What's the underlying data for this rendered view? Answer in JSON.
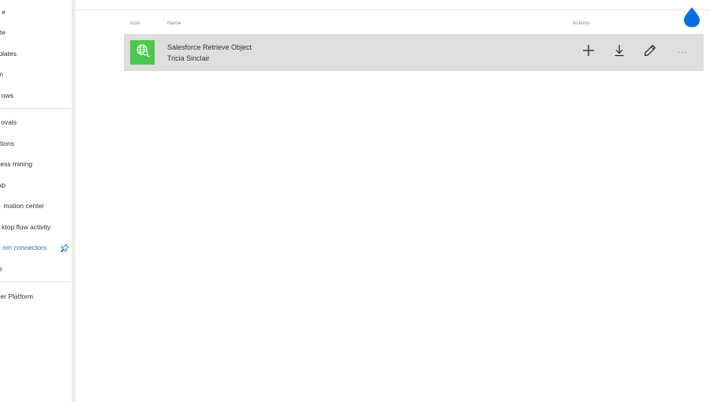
{
  "sidebar": {
    "items": [
      {
        "label": "e"
      },
      {
        "label": "te"
      },
      {
        "label": "plates"
      },
      {
        "label": "n"
      },
      {
        "label": "ows"
      },
      {
        "label": "ovals"
      },
      {
        "label": "tions"
      },
      {
        "label": "ess mining"
      },
      {
        "label": "ab"
      },
      {
        "label": "mation center"
      },
      {
        "label": "ktop flow activity"
      },
      {
        "label": "om connectors"
      },
      {
        "label": "e"
      },
      {
        "label": "er Platform"
      }
    ],
    "active_color": "#2b6cc4"
  },
  "table": {
    "headers": {
      "icon": "Icon",
      "name": "Name",
      "actions": "Actions"
    },
    "rows": [
      {
        "title": "Salesforce Retrieve Object",
        "owner": "Tricia Sinclair",
        "icon": "globe-search-icon",
        "icon_bg": "#4cc94c"
      }
    ]
  },
  "actions": {
    "more_label": "···"
  },
  "accent_color": "#0b6ce8"
}
